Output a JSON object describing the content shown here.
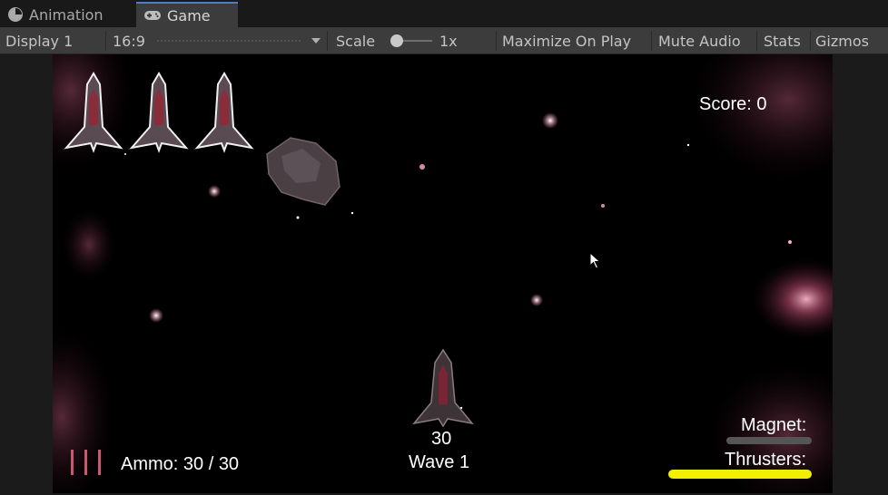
{
  "tabs": [
    {
      "label": "Animation",
      "icon": "animation-clock-icon",
      "active": false
    },
    {
      "label": "Game",
      "icon": "gamepad-icon",
      "active": true
    }
  ],
  "toolbar": {
    "display": "Display 1",
    "aspect": "16:9",
    "scale_label": "Scale",
    "scale_value": "1x",
    "maximize": "Maximize On Play",
    "mute": "Mute Audio",
    "stats": "Stats",
    "gizmos": "Gizmos"
  },
  "hud": {
    "score": "Score: 0",
    "lives": 3,
    "ammo": "Ammo: 30 / 30",
    "ammo_count_above_ship": "30",
    "wave": "Wave 1",
    "magnet_label": "Magnet:",
    "thrusters_label": "Thrusters:",
    "magnet_level": 0,
    "thrusters_level": 1.0,
    "ammo_bars": 3
  },
  "colors": {
    "tab_accent": "#4b7fc0",
    "thruster_bar": "#f2ef00",
    "magnet_bar": "#555555",
    "toolbar_bg": "#3c3c3c",
    "viewport_bg": "#000000"
  }
}
